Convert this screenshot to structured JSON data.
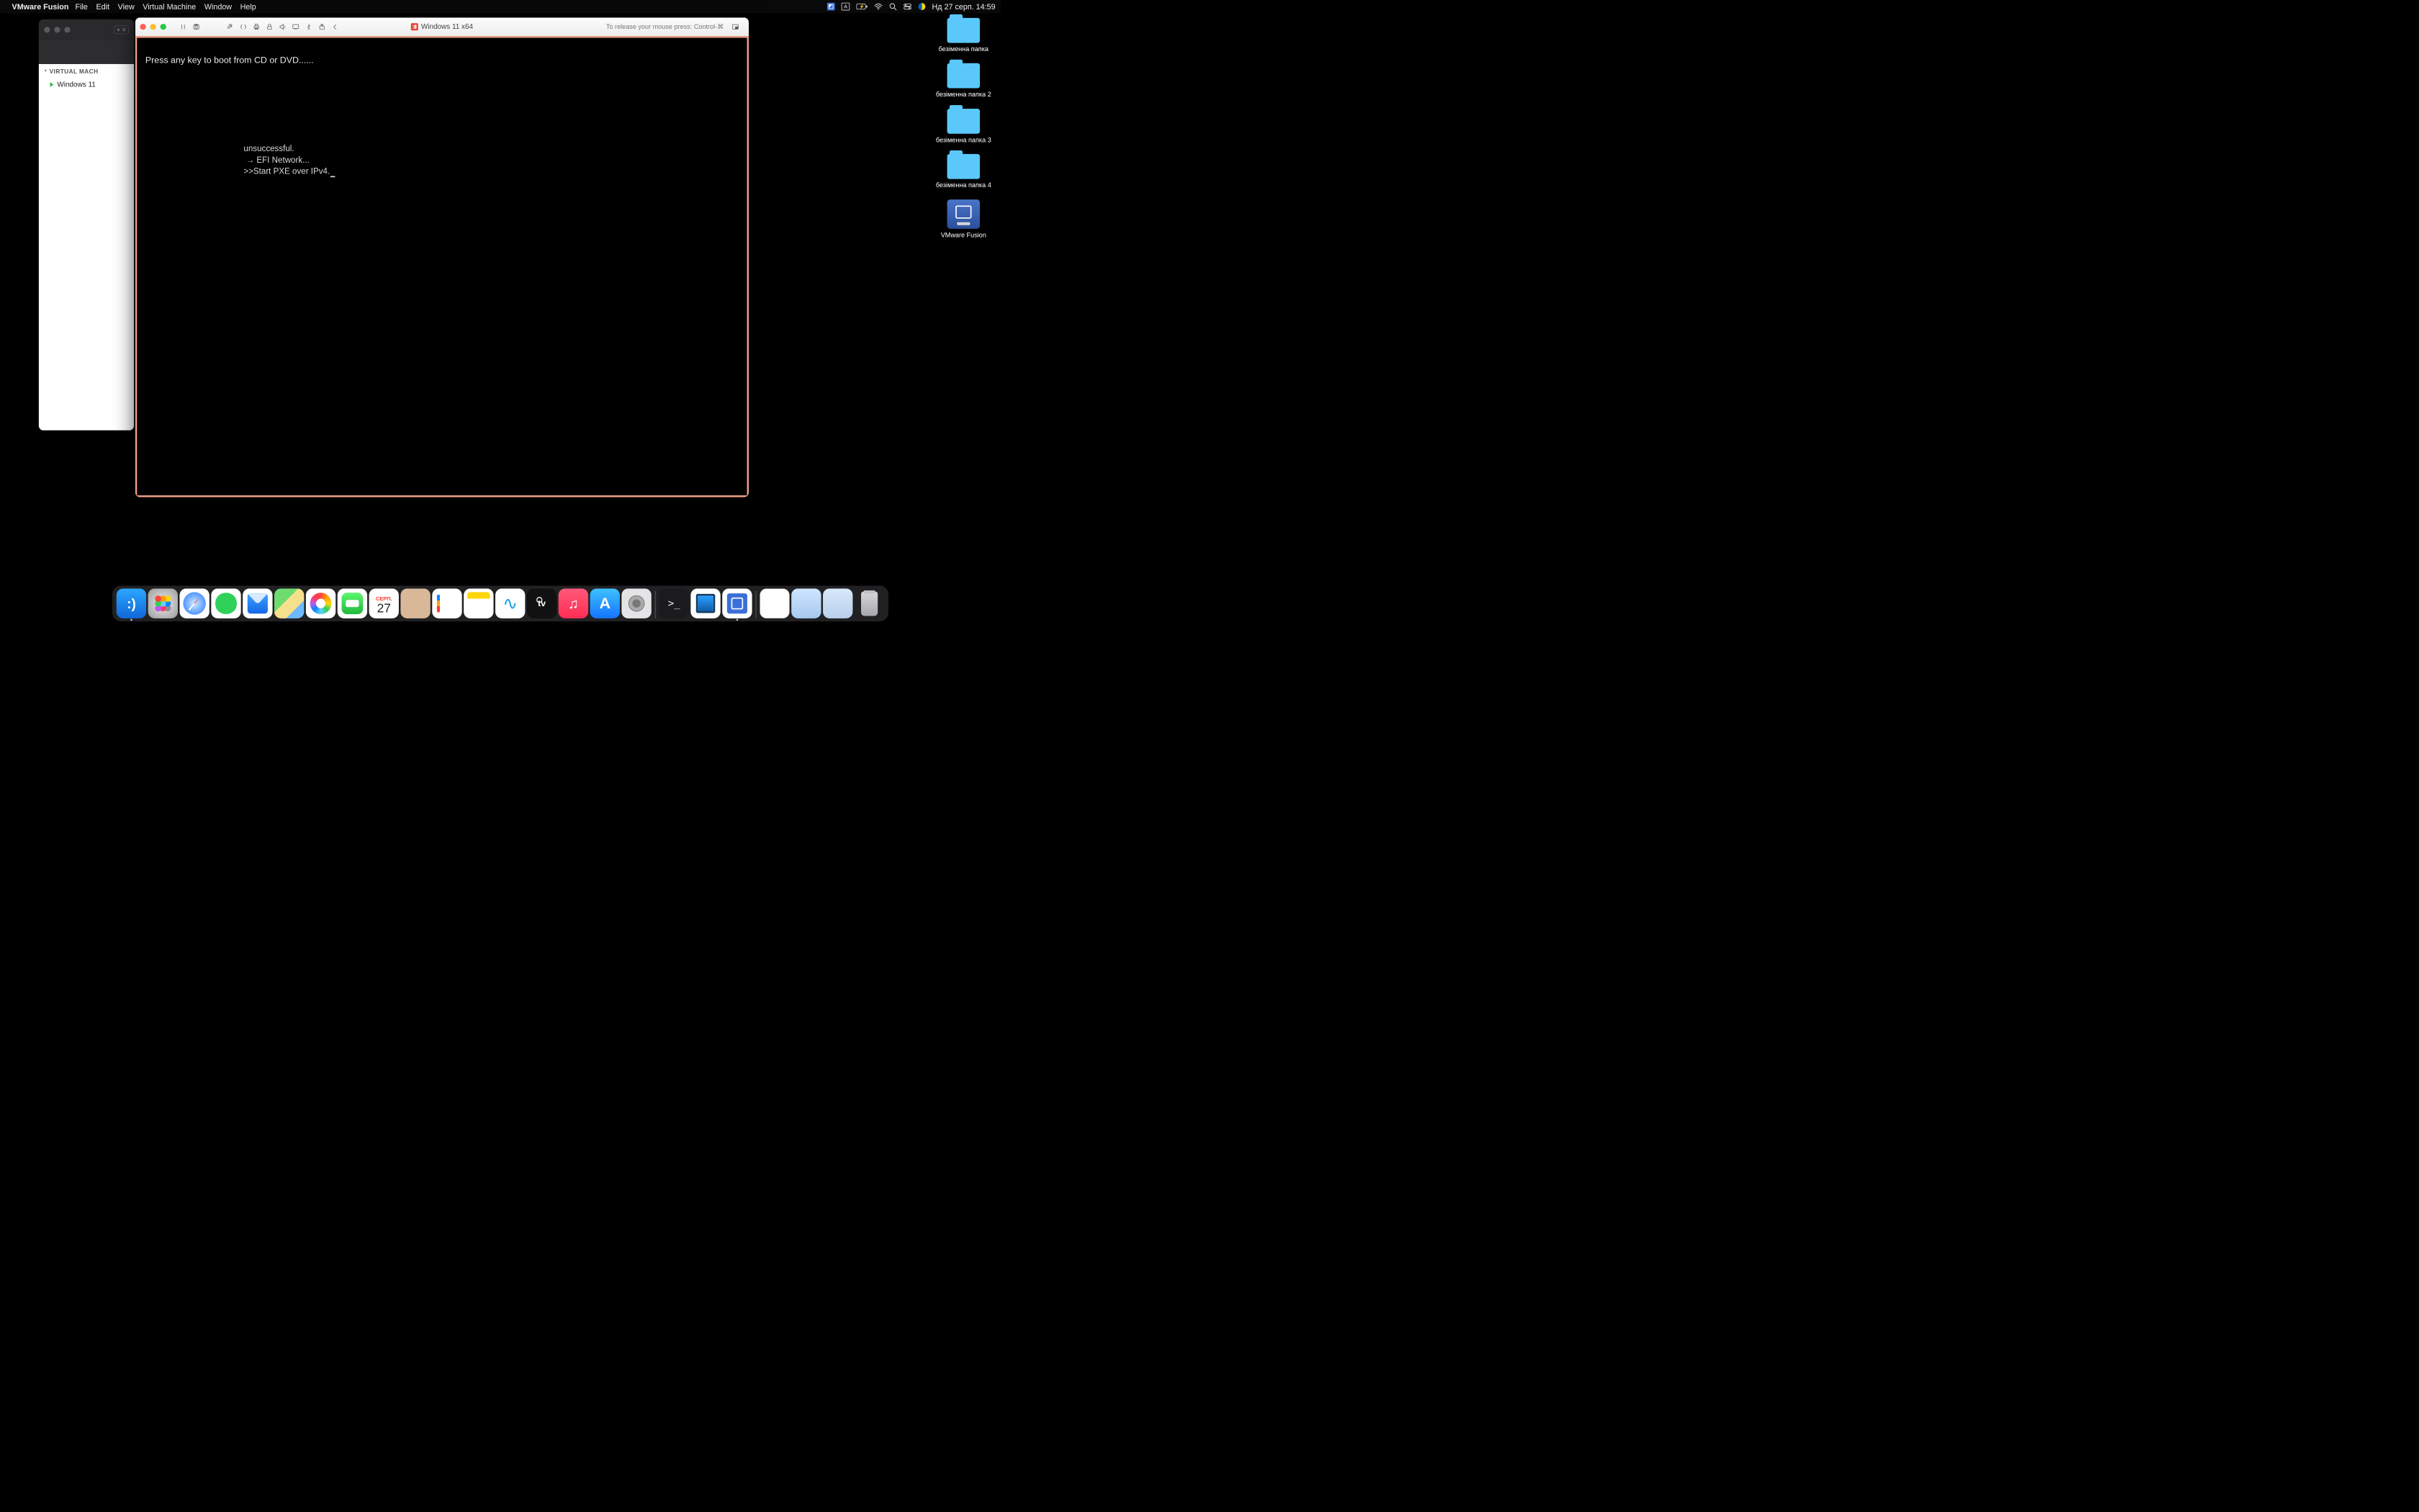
{
  "menubar": {
    "app_name": "VMware Fusion",
    "menus": [
      "File",
      "Edit",
      "View",
      "Virtual Machine",
      "Window",
      "Help"
    ],
    "input_source": "A",
    "battery": "⚡",
    "clock": "Нд 27 серп.  14:59"
  },
  "library": {
    "section": "VIRTUAL MACH",
    "item": "Windows 11",
    "add_label": "+ ˅"
  },
  "vm_window": {
    "title": "Windows 11 x64",
    "hint": "To release your mouse press: Control-⌘"
  },
  "console": {
    "line1": "Press any key to boot from CD or DVD......",
    "line2": "unsuccessful.",
    "line3": " → EFI Network...",
    "line4": ">>Start PXE over IPv4."
  },
  "desktop": {
    "folders": [
      "безіменна папка",
      "безіменна папка 2",
      "безіменна папка 3",
      "безіменна папка 4"
    ],
    "vm_app": "VMware Fusion"
  },
  "dock": {
    "calendar_month": "СЕРП.",
    "calendar_day": "27"
  }
}
